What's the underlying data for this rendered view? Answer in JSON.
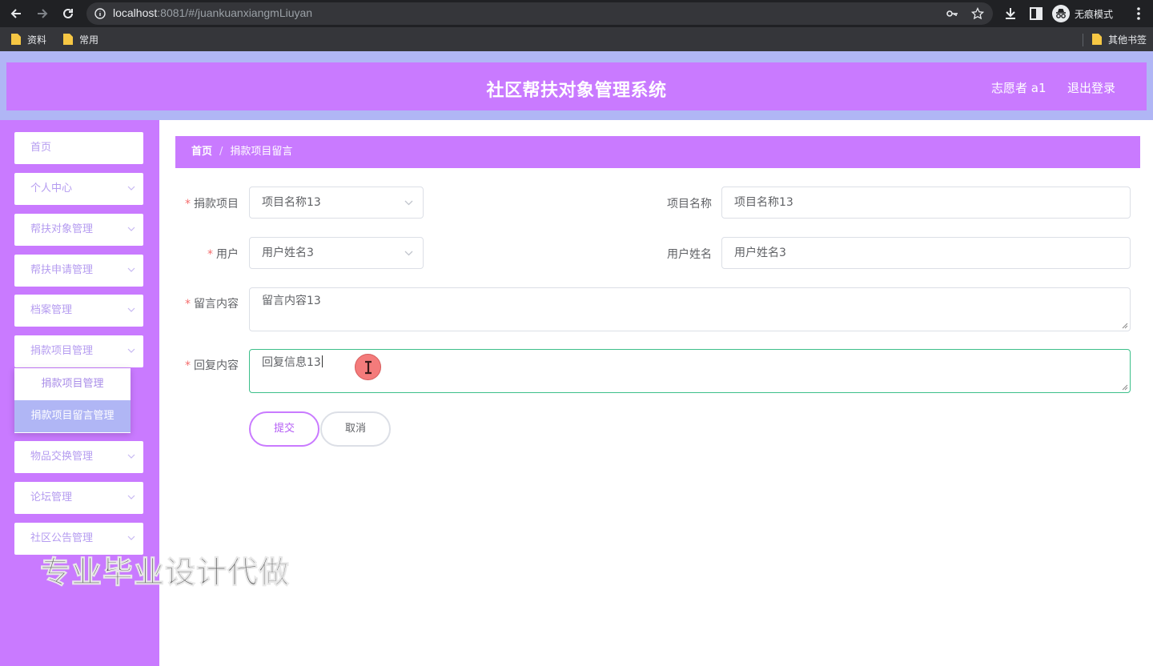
{
  "browser": {
    "url_host": "localhost",
    "url_rest": ":8081/#/juankuanxiangmLiuyan",
    "incognito_label": "无痕模式",
    "bookmarks": [
      "资料",
      "常用"
    ],
    "other_bookmarks": "其他书签"
  },
  "header": {
    "title": "社区帮扶对象管理系统",
    "user": "志愿者 a1",
    "logout": "退出登录"
  },
  "sidebar": {
    "items": [
      {
        "label": "首页",
        "has_chevron": false
      },
      {
        "label": "个人中心",
        "has_chevron": true
      },
      {
        "label": "帮扶对象管理",
        "has_chevron": true
      },
      {
        "label": "帮扶申请管理",
        "has_chevron": true
      },
      {
        "label": "档案管理",
        "has_chevron": true
      },
      {
        "label": "捐款项目管理",
        "has_chevron": true
      },
      {
        "label": "物品交换管理",
        "has_chevron": true
      },
      {
        "label": "论坛管理",
        "has_chevron": true
      },
      {
        "label": "社区公告管理",
        "has_chevron": true
      }
    ],
    "submenu": [
      {
        "label": "捐款项目管理",
        "active": false
      },
      {
        "label": "捐款项目留言管理",
        "active": true
      }
    ]
  },
  "breadcrumb": {
    "home": "首页",
    "separator": "/",
    "current": "捐款项目留言"
  },
  "form": {
    "project_label": "捐款项目",
    "project_value": "项目名称13",
    "project_name_label": "项目名称",
    "project_name_value": "项目名称13",
    "user_label": "用户",
    "user_value": "用户姓名3",
    "username_label": "用户姓名",
    "username_value": "用户姓名3",
    "message_label": "留言内容",
    "message_value": "留言内容13",
    "reply_label": "回复内容",
    "reply_value": "回复信息13",
    "required_mark": "*"
  },
  "buttons": {
    "submit": "提交",
    "cancel": "取消"
  },
  "overlay": {
    "watermark": "专业毕业设计代做"
  },
  "colors": {
    "primary": "#c97aff",
    "header_outer": "#b0b6f5",
    "focus_border": "#3cbf8a",
    "required": "#f56c6c",
    "menu_text": "#b59cf0"
  }
}
